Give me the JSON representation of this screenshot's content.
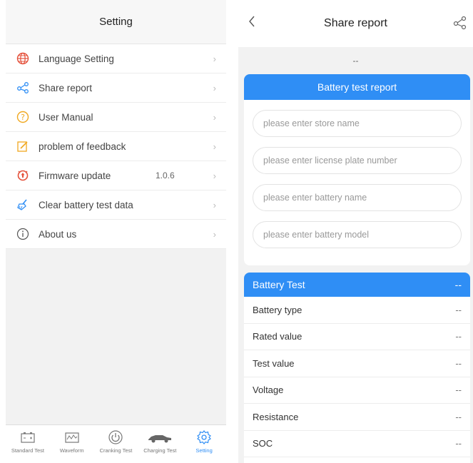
{
  "left": {
    "title": "Setting",
    "menu": [
      {
        "label": "Language Setting",
        "icon": "globe-icon",
        "color": "#e4503a"
      },
      {
        "label": "Share report",
        "icon": "share-icon",
        "color": "#2f8ef5"
      },
      {
        "label": "User Manual",
        "icon": "question-icon",
        "color": "#f0a820"
      },
      {
        "label": "problem of feedback",
        "icon": "edit-icon",
        "color": "#f0a820"
      },
      {
        "label": "Firmware update",
        "icon": "update-icon",
        "color": "#e4503a",
        "value": "1.0.6"
      },
      {
        "label": "Clear battery test data",
        "icon": "broom-icon",
        "color": "#2f8ef5"
      },
      {
        "label": "About us",
        "icon": "info-icon",
        "color": "#555555"
      }
    ],
    "tabs": [
      {
        "label": "Standard Test",
        "icon": "battery-icon"
      },
      {
        "label": "Waveform",
        "icon": "waveform-icon"
      },
      {
        "label": "Cranking Test",
        "icon": "power-icon"
      },
      {
        "label": "Charging Test",
        "icon": "car-icon"
      },
      {
        "label": "Setting",
        "icon": "gear-icon",
        "active": true
      }
    ]
  },
  "right": {
    "title": "Share report",
    "top_dash": "--",
    "report_title": "Battery test report",
    "placeholders": {
      "store": "please enter store name",
      "plate": "please enter license plate number",
      "battery_name": "please enter battery name",
      "battery_model": "please enter battery model"
    },
    "battery_test": {
      "title": "Battery Test",
      "value": "--",
      "rows": [
        {
          "label": "Battery type",
          "value": "--"
        },
        {
          "label": "Rated value",
          "value": "--"
        },
        {
          "label": "Test value",
          "value": "--"
        },
        {
          "label": "Voltage",
          "value": "--"
        },
        {
          "label": "Resistance",
          "value": "--"
        },
        {
          "label": "SOC",
          "value": "--"
        }
      ]
    }
  },
  "colors": {
    "accent": "#2f8ef5"
  }
}
